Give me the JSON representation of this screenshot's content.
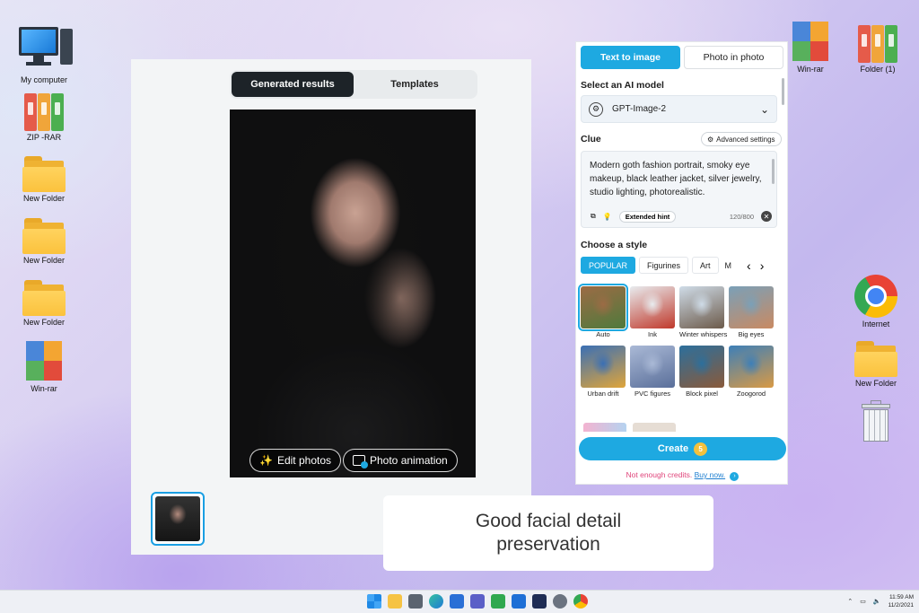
{
  "desktop": {
    "left_icons": [
      {
        "label": "My computer",
        "icon": "computer-icon"
      },
      {
        "label": "ZIP -RAR",
        "icon": "binders-icon"
      },
      {
        "label": "New Folder",
        "icon": "folder-icon"
      },
      {
        "label": "New Folder",
        "icon": "folder-icon"
      },
      {
        "label": "New Folder",
        "icon": "folder-icon"
      },
      {
        "label": "Win-rar",
        "icon": "winrar-icon"
      }
    ],
    "right_icons": [
      {
        "label": "Win-rar",
        "icon": "winrar-icon"
      },
      {
        "label": "Folder (1)",
        "icon": "binders-icon"
      },
      {
        "label": "Internet",
        "icon": "chrome-icon"
      },
      {
        "label": "New Folder",
        "icon": "folder-icon"
      },
      {
        "label": "",
        "icon": "recycle-bin-icon"
      }
    ]
  },
  "results_panel": {
    "tabs": [
      {
        "label": "Generated results",
        "active": true
      },
      {
        "label": "Templates",
        "active": false
      }
    ],
    "image_actions": {
      "edit": "Edit photos",
      "animate": "Photo animation"
    }
  },
  "generator_panel": {
    "mode_tabs": [
      {
        "label": "Text to image",
        "active": true
      },
      {
        "label": "Photo in photo",
        "active": false
      }
    ],
    "model_section_title": "Select an AI model",
    "model_value": "GPT-Image-2",
    "clue_title": "Clue",
    "advanced_settings": "Advanced settings",
    "prompt_text": "Modern goth fashion portrait, smoky eye makeup, black leather jacket, silver jewelry, studio lighting, photorealistic.",
    "extended_hint": "Extended hint",
    "char_count": "120/800",
    "style_title": "Choose a style",
    "style_chips": [
      {
        "label": "POPULAR",
        "active": true
      },
      {
        "label": "Figurines",
        "active": false
      },
      {
        "label": "Art",
        "active": false
      },
      {
        "label": "M",
        "active": false
      }
    ],
    "styles": [
      {
        "label": "Auto",
        "selected": true,
        "c1": "#9c6b45",
        "c2": "#4f7a3c"
      },
      {
        "label": "Ink",
        "selected": false,
        "c1": "#e8ecef",
        "c2": "#c0392b"
      },
      {
        "label": "Winter whispers",
        "selected": false,
        "c1": "#cfdce8",
        "c2": "#6c5a4a"
      },
      {
        "label": "Big eyes",
        "selected": false,
        "c1": "#7aa0b8",
        "c2": "#c98a62"
      },
      {
        "label": "Urban drift",
        "selected": false,
        "c1": "#3a6fb5",
        "c2": "#e0a53a"
      },
      {
        "label": "PVC figures",
        "selected": false,
        "c1": "#aab9d6",
        "c2": "#5a6f9a"
      },
      {
        "label": "Block pixel",
        "selected": false,
        "c1": "#2c6f9c",
        "c2": "#8a5a3a"
      },
      {
        "label": "Zoogorod",
        "selected": false,
        "c1": "#3d7fb8",
        "c2": "#d99a45"
      }
    ],
    "create_label": "Create",
    "create_cost": "5",
    "credits_msg": "Not enough credits.",
    "buy_now": "Buy now.",
    "buy_arrow": "›"
  },
  "caption": {
    "line1": "Good facial detail",
    "line2": "preservation"
  },
  "taskbar": {
    "time": "11:59 AM",
    "date": "11/2/2021"
  }
}
